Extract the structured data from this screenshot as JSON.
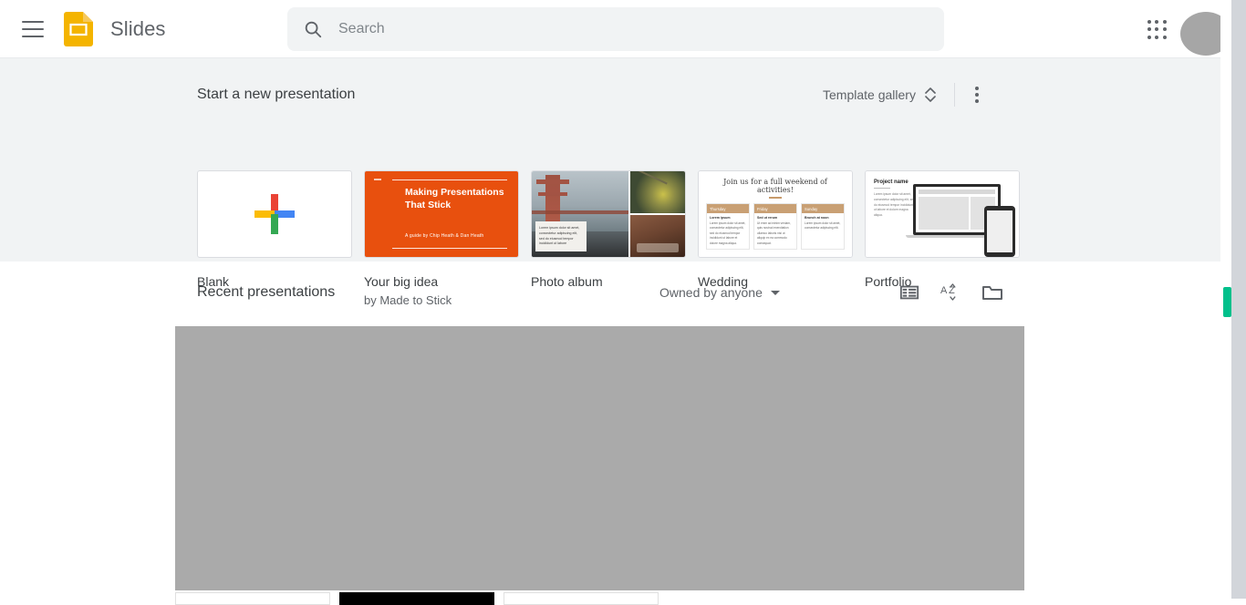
{
  "header": {
    "menu_icon": "hamburger-menu-icon",
    "logo_icon": "google-slides-logo",
    "brand": "Slides",
    "search": {
      "value": "",
      "placeholder": "Search",
      "icon": "search-icon"
    },
    "apps_icon": "google-apps-grid-icon",
    "avatar": "account-avatar"
  },
  "templates": {
    "title": "Start a new presentation",
    "gallery_button": "Template gallery",
    "gallery_toggle_icon": "chevron-up-down-icon",
    "more_icon": "more-vert-icon",
    "cards": [
      {
        "label": "Blank",
        "sublabel": "",
        "thumb": "google-plus-icon"
      },
      {
        "label": "Your big idea",
        "sublabel": "by Made to Stick",
        "thumb": "big-idea-template",
        "slide_title": "Making Presentations That Stick",
        "slide_credit": "A guide by Chip Heath & Dan Heath"
      },
      {
        "label": "Photo album",
        "sublabel": "",
        "thumb": "photo-album-template"
      },
      {
        "label": "Wedding",
        "sublabel": "",
        "thumb": "wedding-template",
        "slide_title": "Join us for a full weekend of activities!",
        "columns": [
          {
            "day": "Thursday",
            "heading": "Lorem ipsum",
            "body": "Lorem ipsum dolor sit amet, consectetur adipiscing elit, sed do eiusmod tempor incididunt ut labore et dolore magna aliqua."
          },
          {
            "day": "Friday",
            "heading": "Sed ut rerum",
            "body": "Ut enim ad minim veniam, quis nostrud exercitation ullamco laboris nisi ut aliquip ex ea commodo consequat."
          },
          {
            "day": "Sunday",
            "heading": "Brunch at noon",
            "body": "Lorem ipsum dolor sit amet, consectetur adipiscing elit."
          }
        ]
      },
      {
        "label": "Portfolio",
        "sublabel": "",
        "thumb": "portfolio-template",
        "slide_title": "Project name",
        "slide_body": "Lorem ipsum dolor sit amet, consectetur adipiscing elit, sed do eiusmod tempor incididunt ut labore et dolore magna aliqua."
      }
    ]
  },
  "recent": {
    "title": "Recent presentations",
    "owner_filter": "Owned by anyone",
    "list_view_icon": "list-view-icon",
    "sort_icon": "sort-az-icon",
    "folder_icon": "open-folder-icon"
  },
  "scrollbar": {
    "thumb_color": "#00c08b"
  },
  "colors": {
    "brand_yellow": "#F4B400",
    "page_gray": "#F1F3F4",
    "text_primary": "#3c4043",
    "text_secondary": "#5f6368"
  }
}
